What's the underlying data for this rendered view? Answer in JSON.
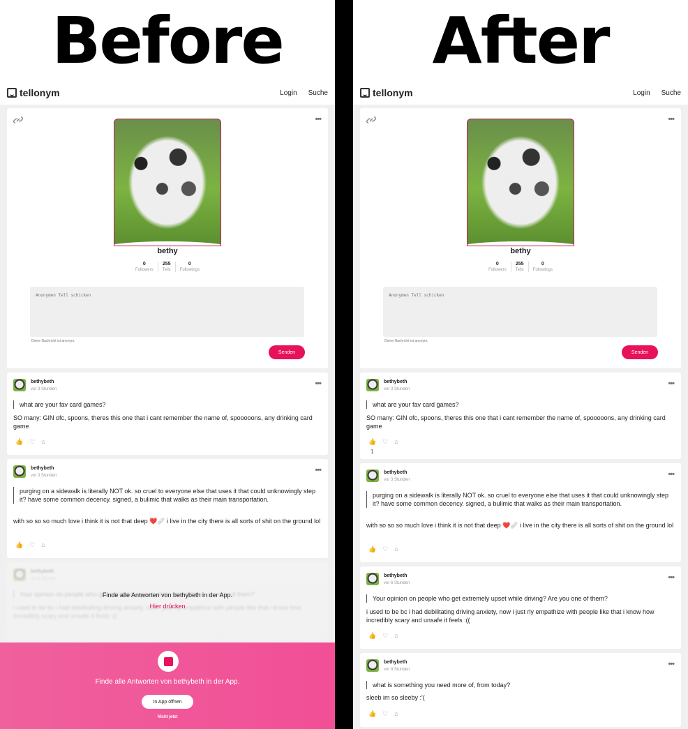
{
  "headings": {
    "before": "Before",
    "after": "After"
  },
  "app": {
    "logo": "tellonym",
    "nav_login": "Login",
    "nav_search": "Suche"
  },
  "profile": {
    "name": "bethy",
    "stats": [
      {
        "value": "0",
        "label": "Followers"
      },
      {
        "value": "255",
        "label": "Tells"
      },
      {
        "value": "0",
        "label": "Followings"
      }
    ],
    "tell_placeholder": "Anonymen Tell schicken",
    "note": "Deine Nachricht ist anonym.",
    "send_label": "Senden",
    "menu_dots": "•••"
  },
  "posts": [
    {
      "author": "bethybeth",
      "time": "vor 3 Stunden",
      "question": "what are your fav card games?",
      "answer": "SO many: GIN ofc, spoons, theres this one that i cant remember the name of, spooooons, any drinking card game"
    },
    {
      "author": "bethybeth",
      "time": "vor 3 Stunden",
      "question": "purging on a sidewalk is literally NOT ok. so cruel to everyone else that uses it that could unknowingly step it?  have some common decency. signed, a bulimic that walks as their main transportation.",
      "answer": "with so so so much love i think it is not that deep ❤️🩹 i live in the city there is all sorts of shit on the ground lol"
    },
    {
      "author": "bethybeth",
      "time": "vor 6 Stunden",
      "question": "Your opinion on people who get extremely upset while driving? Are you one of them?",
      "answer": "i used to be bc i had debilitating driving anxiety, now i just rly empathize with people like that i know how incredibly scary and unsafe it feels :(("
    },
    {
      "author": "bethybeth",
      "time": "vor 8 Stunden",
      "question": "what is something you need more of, from today?",
      "answer": "sleeb im so sleeby :'("
    }
  ],
  "like_count_after": "1",
  "blur_overlay": {
    "text": "Finde alle Antworten von bethybeth in der App.",
    "link": "Hier drücken"
  },
  "promo": {
    "text": "Finde alle Antworten von bethybeth in der App.",
    "button": "In App öffnen",
    "later": "Nicht jetzt"
  },
  "icons": [
    "tellonym-logo-icon",
    "link-icon",
    "thumbs-up-icon",
    "heart-icon",
    "share-icon"
  ],
  "colors": {
    "accent": "#e8115b",
    "promo_bg": "#f0609d",
    "page_bg": "#f0f0f0"
  }
}
